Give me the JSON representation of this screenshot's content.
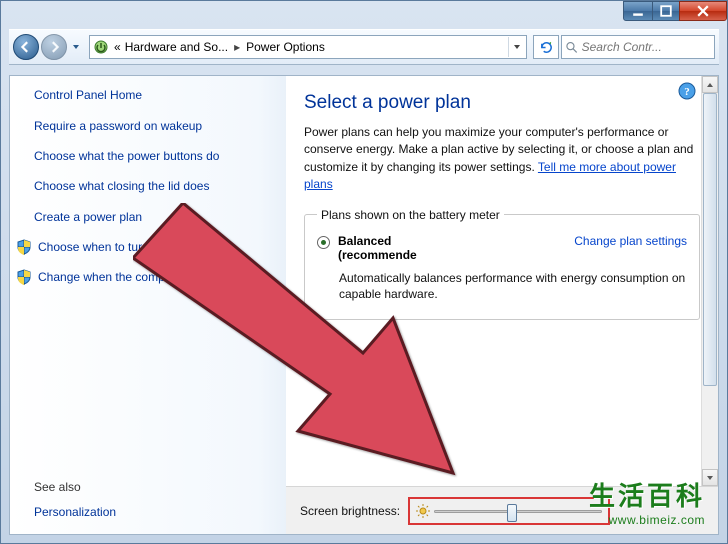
{
  "breadcrumb": {
    "seg1": "Hardware and So...",
    "seg2": "Power Options"
  },
  "search": {
    "placeholder": "Search Contr..."
  },
  "sidebar": {
    "home": "Control Panel Home",
    "links": [
      "Require a password on wakeup",
      "Choose what the power buttons do",
      "Choose what closing the lid does",
      "Create a power plan",
      "Choose when to turn off the display",
      "Change when the computer sleeps"
    ],
    "see_also": "See also",
    "personalization": "Personalization"
  },
  "main": {
    "title": "Select a power plan",
    "desc_prefix": "Power plans can help you maximize your computer's performance or conserve energy. Make a plan active by selecting it, or choose a plan and customize it by changing its power settings. ",
    "desc_link": "Tell me more about power plans",
    "fieldset_legend": "Plans shown on the battery meter",
    "plan_name": "Balanced",
    "plan_rec": "(recommende",
    "change_settings": "Change plan settings",
    "plan_desc": "Automatically balances performance with energy consumption on capable hardware."
  },
  "bottom": {
    "label": "Screen brightness:",
    "slider_pos_percent": 46
  },
  "watermark": {
    "ch": "生活百科",
    "url": "www.bimeiz.com"
  }
}
